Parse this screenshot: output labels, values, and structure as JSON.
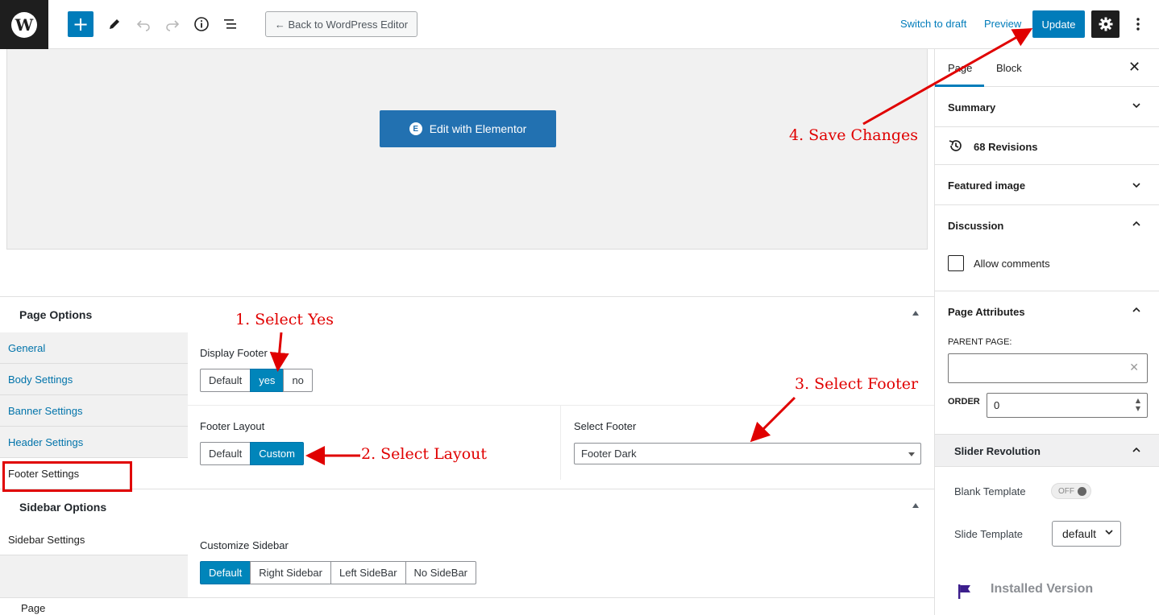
{
  "topbar": {
    "wp_logo": "W",
    "add_symbol": "+",
    "back_label": "← Back to WordPress Editor",
    "switch_to_draft": "Switch to draft",
    "preview": "Preview",
    "update": "Update"
  },
  "canvas": {
    "elementor_label": "Edit with Elementor",
    "elementor_badge": "E"
  },
  "page_options": {
    "title": "Page Options",
    "tabs": [
      {
        "label": "General"
      },
      {
        "label": "Body Settings"
      },
      {
        "label": "Banner Settings"
      },
      {
        "label": "Header Settings"
      },
      {
        "label": "Footer Settings"
      }
    ],
    "display_footer": {
      "label": "Display Footer",
      "options": [
        "Default",
        "yes",
        "no"
      ],
      "selected": "yes"
    },
    "footer_layout": {
      "label": "Footer Layout",
      "options": [
        "Default",
        "Custom"
      ],
      "selected": "Custom"
    },
    "select_footer": {
      "label": "Select Footer",
      "value": "Footer Dark"
    }
  },
  "sidebar_options": {
    "title": "Sidebar Options",
    "tab": "Sidebar Settings",
    "customize": {
      "label": "Customize Sidebar",
      "options": [
        "Default",
        "Right Sidebar",
        "Left SideBar",
        "No SideBar"
      ],
      "selected": "Default"
    }
  },
  "footer_breadcrumb": "Page",
  "settings_sidebar": {
    "tabs": [
      "Page",
      "Block"
    ],
    "active_tab": "Page",
    "close": "✕",
    "summary": "Summary",
    "revisions": "68 Revisions",
    "featured_image": "Featured image",
    "discussion": "Discussion",
    "allow_comments": "Allow comments",
    "page_attributes": "Page Attributes",
    "parent_page_label": "PARENT PAGE:",
    "order_label": "ORDER",
    "order_value": "0",
    "slider_revolution": "Slider Revolution",
    "blank_template": "Blank Template",
    "blank_template_state": "OFF",
    "slide_template": "Slide Template",
    "slide_template_value": "default",
    "installed_version": "Installed Version"
  },
  "annotations": {
    "step1": "1. Select Yes",
    "step2": "2. Select Layout",
    "step3": "3. Select Footer",
    "step4": "4. Save Changes",
    "color": "#e00000"
  },
  "colors": {
    "primary": "#007cba",
    "selected_segment": "#0085ba",
    "dark": "#1e1e1e"
  }
}
